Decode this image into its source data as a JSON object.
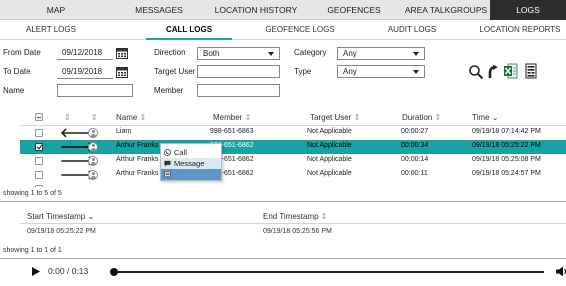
{
  "nav": {
    "tabs": [
      {
        "label": "MAP"
      },
      {
        "label": "MESSAGES"
      },
      {
        "label": "LOCATION HISTORY"
      },
      {
        "label": "GEOFENCES"
      },
      {
        "label": "AREA TALKGROUPS"
      },
      {
        "label": "LOGS",
        "active": true
      }
    ]
  },
  "subnav": {
    "tabs": [
      {
        "label": "ALERT LOGS"
      },
      {
        "label": "CALL LOGS",
        "active": true
      },
      {
        "label": "GEOFENCE LOGS"
      },
      {
        "label": "AUDIT LOGS"
      },
      {
        "label": "LOCATION REPORTS"
      }
    ]
  },
  "filters": {
    "from_date_label": "From Date",
    "from_date_value": "09/12/2018",
    "to_date_label": "To Date",
    "to_date_value": "09/19/2018",
    "name_label": "Name",
    "name_value": "",
    "direction_label": "Direction",
    "direction_value": "Both",
    "target_user_label": "Target User",
    "target_user_value": "",
    "member_label": "Member",
    "member_value": "",
    "category_label": "Category",
    "category_value": "Any",
    "type_label": "Type",
    "type_value": "Any"
  },
  "grid": {
    "headers": {
      "name": "Name",
      "member": "Member",
      "target_user": "Target User",
      "duration": "Duration",
      "time": "Time"
    },
    "rows": [
      {
        "direction": "incoming",
        "checked": false,
        "name": "Liam",
        "member": "998-651-6863",
        "target_user": "Not Applicable",
        "duration": "00:00:27",
        "time": "09/19/18 07:14:42 PM"
      },
      {
        "direction": "outgoing",
        "checked": true,
        "selected": true,
        "name": "Arthur Franks",
        "member": "998-651-6862",
        "target_user": "Not Applicable",
        "duration": "00:00:34",
        "time": "09/19/18 05:25:22 PM"
      },
      {
        "direction": "outgoing",
        "checked": false,
        "name": "Arthur Franks",
        "member": "998-651-6862",
        "target_user": "Not Applicable",
        "duration": "00:00:14",
        "time": "09/19/18 05:25:08 PM"
      },
      {
        "direction": "outgoing",
        "checked": false,
        "name": "Arthur Franks",
        "member": "998-651-6862",
        "target_user": "Not Applicable",
        "duration": "00:00:11",
        "time": "09/19/18 05:24:57 PM"
      }
    ],
    "status": "showing 1 to 5 of 5"
  },
  "context_menu": {
    "items": [
      {
        "label": "Call",
        "icon": "phone-icon"
      },
      {
        "label": "Message",
        "icon": "message-icon"
      },
      {
        "label": "",
        "icon": "document-icon",
        "highlighted": true
      }
    ]
  },
  "detail": {
    "headers": {
      "start": "Start Timestamp",
      "end": "End Timestamp"
    },
    "rows": [
      {
        "start": "09/19/18 05:25:22 PM",
        "end": "09/19/18 05:25:56 PM"
      }
    ],
    "status": "showing 1 to 1 of 1"
  },
  "player": {
    "time_label": "0:00 / 0:13",
    "progress": 0
  },
  "colors": {
    "selected_row": "#18a2a6",
    "active_tab_bg": "#2d2d2d",
    "menu_highlight": "#5f97cc"
  }
}
